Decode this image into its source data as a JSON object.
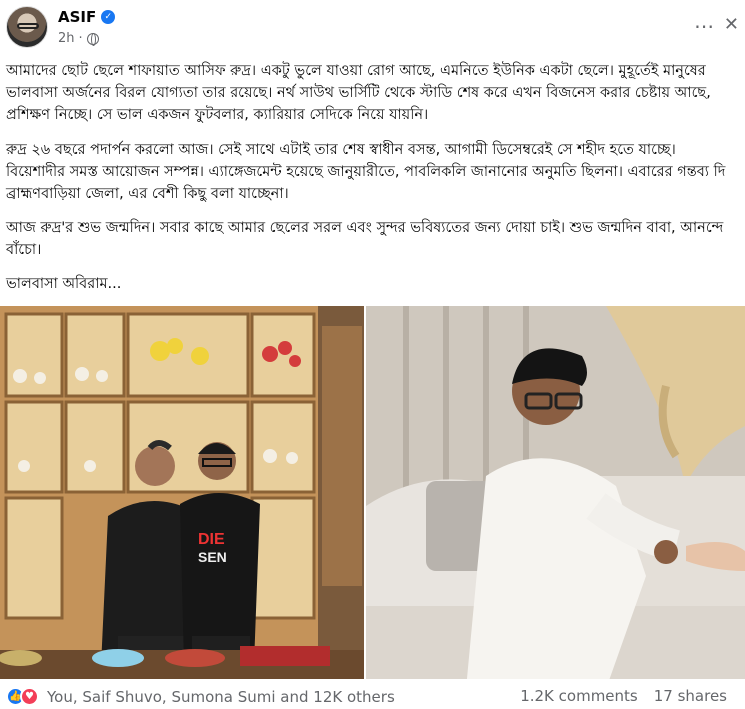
{
  "post": {
    "author": "ASIF",
    "time": "2h",
    "more_icon": "⋯",
    "close_icon": "✕"
  },
  "text": {
    "p1": "আমাদের ছোট ছেলে শাফায়াত আসিফ রুদ্র। একটু ভুলে যাওয়া রোগ আছে, এমনিতে ইউনিক একটা ছেলে। মুহূর্তেই মানুষের ভালবাসা অর্জনের বিরল যোগ্যতা তার রয়েছে। নর্থ সাউথ ভার্সিটি থেকে স্টাডি শেষ করে এখন বিজনেস করার চেষ্টায় আছে, প্রশিক্ষণ নিচ্ছে। সে ভাল একজন ফুটবলার, ক্যারিয়ার সেদিকে নিয়ে যায়নি।",
    "p2": "রুদ্র ২৬ বছরে পদার্পন করলো আজ। সেই সাথে এটাই তার শেষ স্বাধীন বসন্ত, আগামী ডিসেম্বরেই সে শহীদ হতে যাচ্ছে। বিয়েশাদীর সমস্ত আয়োজন সম্পন্ন। এ্যাঙ্গেজমেন্ট হয়েছে জানুয়ারীতে, পাবলিকলি জানানোর অনুমতি ছিলনা। এবারের গন্তব্য দি ব্রাহ্মণবাড়িয়া জেলা, এর বেশী কিছু বলা যাচ্ছেনা।",
    "p3": "আজ রুদ্র'র শুভ জন্মদিন। সবার কাছে আমার ছেলের সরল এবং সুন্দর ভবিষ্যতের জন্য দোয়া চাই। শুভ জন্মদিন বাবা, আনন্দে বাঁচো।",
    "p4": "ভালবাসা অবিরাম..."
  },
  "photos": {
    "left_shirt_text": "DIE",
    "left_shirt_text2": "SEN"
  },
  "footer": {
    "reaction_names": "You, Saif Shuvo, Sumona Sumi and 12K others",
    "comments": "1.2K comments",
    "shares": "17 shares"
  }
}
